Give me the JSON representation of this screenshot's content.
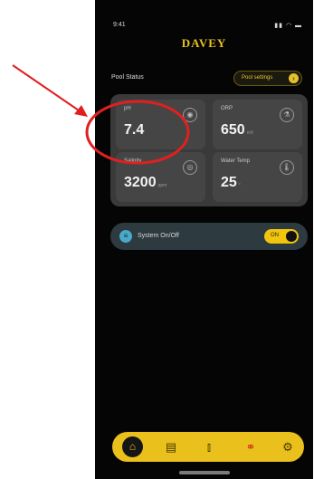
{
  "status_bar": {
    "time": "9:41",
    "icons": "..ıl ᯤ ▬"
  },
  "app": {
    "logo": "DAVEY"
  },
  "pool_status": {
    "title": "Pool Status",
    "settings_label": "Pool settings",
    "settings_icon": "chevron-right-icon"
  },
  "tiles": [
    {
      "label": "pH",
      "value": "7.4",
      "unit": "",
      "icon": "ph-icon"
    },
    {
      "label": "ORP",
      "value": "650",
      "unit": "mV",
      "icon": "flask-icon"
    },
    {
      "label": "Salinity",
      "value": "3200",
      "unit": "ppm",
      "icon": "salt-icon"
    },
    {
      "label": "Water Temp",
      "value": "25",
      "unit": "°",
      "icon": "thermometer-icon"
    }
  ],
  "system_toggle": {
    "label": "System On/Off",
    "state": "ON"
  },
  "nav": {
    "items": [
      {
        "name": "home",
        "icon": "home-icon"
      },
      {
        "name": "schedule",
        "icon": "calendar-icon"
      },
      {
        "name": "stats",
        "icon": "chart-icon"
      },
      {
        "name": "chemicals",
        "icon": "chemicals-icon"
      },
      {
        "name": "settings",
        "icon": "gear-icon"
      }
    ]
  },
  "annotation": {
    "color": "#e02020"
  }
}
